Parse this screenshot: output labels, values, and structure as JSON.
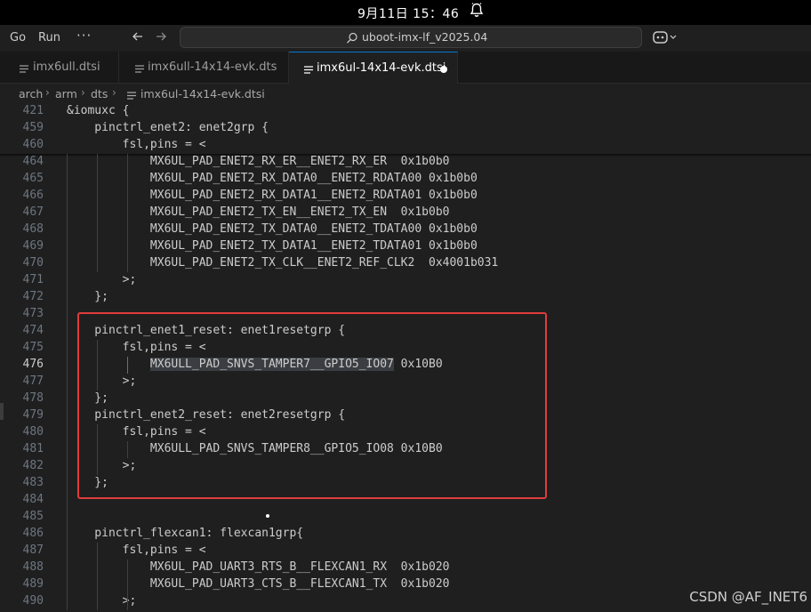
{
  "system": {
    "clock": "9月11日 15：46",
    "bell_icon": "bell-icon"
  },
  "titlebar": {
    "menu": [
      "Go",
      "Run"
    ],
    "more": "···",
    "search_text": "uboot-imx-lf_v2025.04"
  },
  "tabs": [
    {
      "label": "imx6ull.dtsi",
      "active": false
    },
    {
      "label": "imx6ull-14x14-evk.dts",
      "active": false
    },
    {
      "label": "imx6ul-14x14-evk.dtsi",
      "active": true,
      "modified": true
    }
  ],
  "breadcrumb": [
    "arch",
    "arm",
    "dts",
    "imx6ul-14x14-evk.dtsi"
  ],
  "editor": {
    "sticky": [
      {
        "n": "421",
        "text": "&iomuxc {"
      },
      {
        "n": "459",
        "text": "    pinctrl_enet2: enet2grp {"
      },
      {
        "n": "460",
        "text": "        fsl,pins = <"
      }
    ],
    "lines": [
      {
        "n": "464",
        "text": "            MX6UL_PAD_ENET2_RX_ER__ENET2_RX_ER  0x1b0b0"
      },
      {
        "n": "465",
        "text": "            MX6UL_PAD_ENET2_RX_DATA0__ENET2_RDATA00 0x1b0b0"
      },
      {
        "n": "466",
        "text": "            MX6UL_PAD_ENET2_RX_DATA1__ENET2_RDATA01 0x1b0b0"
      },
      {
        "n": "467",
        "text": "            MX6UL_PAD_ENET2_TX_EN__ENET2_TX_EN  0x1b0b0"
      },
      {
        "n": "468",
        "text": "            MX6UL_PAD_ENET2_TX_DATA0__ENET2_TDATA00 0x1b0b0"
      },
      {
        "n": "469",
        "text": "            MX6UL_PAD_ENET2_TX_DATA1__ENET2_TDATA01 0x1b0b0"
      },
      {
        "n": "470",
        "text": "            MX6UL_PAD_ENET2_TX_CLK__ENET2_REF_CLK2  0x4001b031"
      },
      {
        "n": "471",
        "text": "        >;"
      },
      {
        "n": "472",
        "text": "    };"
      },
      {
        "n": "473",
        "text": ""
      },
      {
        "n": "474",
        "text": "    pinctrl_enet1_reset: enet1resetgrp {"
      },
      {
        "n": "475",
        "text": "        fsl,pins = <"
      },
      {
        "n": "476",
        "pre": "            ",
        "sel": "MX6ULL_PAD_SNVS_TAMPER7__GPIO5_IO07",
        "post": " 0x10B0",
        "current": true
      },
      {
        "n": "477",
        "text": "        >;"
      },
      {
        "n": "478",
        "text": "    };"
      },
      {
        "n": "479",
        "text": "    pinctrl_enet2_reset: enet2resetgrp {"
      },
      {
        "n": "480",
        "text": "        fsl,pins = <"
      },
      {
        "n": "481",
        "text": "            MX6ULL_PAD_SNVS_TAMPER8__GPIO5_IO08 0x10B0"
      },
      {
        "n": "482",
        "text": "        >;"
      },
      {
        "n": "483",
        "text": "    };"
      },
      {
        "n": "484",
        "text": ""
      },
      {
        "n": "485",
        "text": ""
      },
      {
        "n": "486",
        "text": "    pinctrl_flexcan1: flexcan1grp{"
      },
      {
        "n": "487",
        "text": "        fsl,pins = <"
      },
      {
        "n": "488",
        "text": "            MX6UL_PAD_UART3_RTS_B__FLEXCAN1_RX  0x1b020"
      },
      {
        "n": "489",
        "text": "            MX6UL_PAD_UART3_CTS_B__FLEXCAN1_TX  0x1b020"
      },
      {
        "n": "490",
        "text": "        >;"
      }
    ]
  },
  "watermark": "CSDN @AF_INET6",
  "colors": {
    "accent": "#0078d4",
    "annotation": "#e03c3c",
    "background": "#1f1f1f"
  }
}
